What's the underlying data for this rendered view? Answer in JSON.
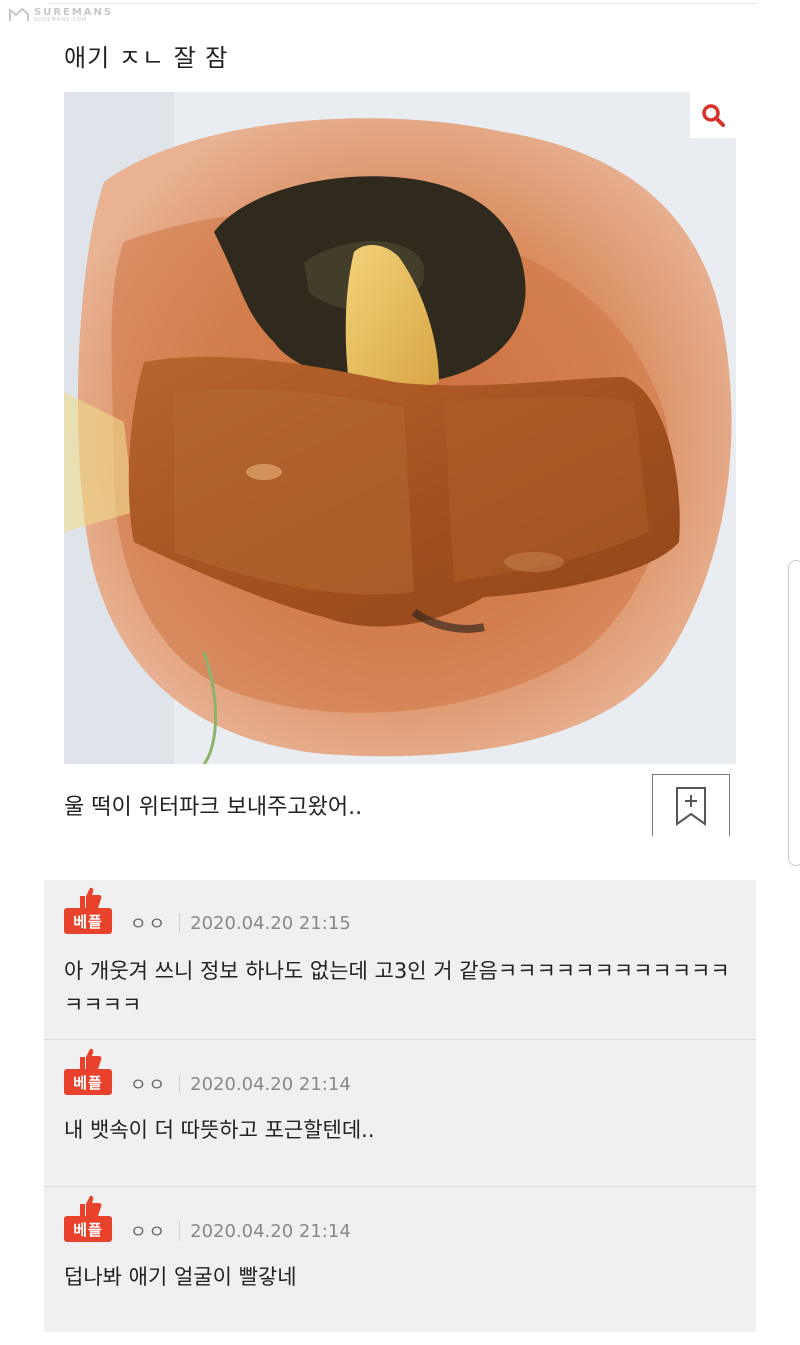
{
  "watermark": {
    "main": "SUREMANS",
    "sub": "SUREMANS.COM"
  },
  "post": {
    "title": "애기 ㅈㄴ 잘 잠",
    "caption": "울 떡이 위터파크 보내주고왔어..",
    "image_icon": "photo-of-fish-cake-in-sauce",
    "zoom_icon": "magnifier-icon",
    "bookmark_icon": "bookmark-plus-icon"
  },
  "comments": [
    {
      "badge": "베플",
      "nick": "ㅇㅇ",
      "date": "2020.04.20 21:15",
      "text": "아 개웃겨 쓰니 정보 하나도 없는데 고3인 거 같음ㅋㅋㅋㅋㅋㅋㅋㅋㅋㅋㅋㅋㅋㅋㅋㅋ"
    },
    {
      "badge": "베플",
      "nick": "ㅇㅇ",
      "date": "2020.04.20 21:14",
      "text": "내 뱃속이 더 따뜻하고 포근할텐데.."
    },
    {
      "badge": "베플",
      "nick": "ㅇㅇ",
      "date": "2020.04.20 21:14",
      "text": "덥나봐 애기 얼굴이 빨갛네"
    }
  ],
  "colors": {
    "accent": "#e8412c",
    "comment_bg": "#f0f0f0"
  }
}
